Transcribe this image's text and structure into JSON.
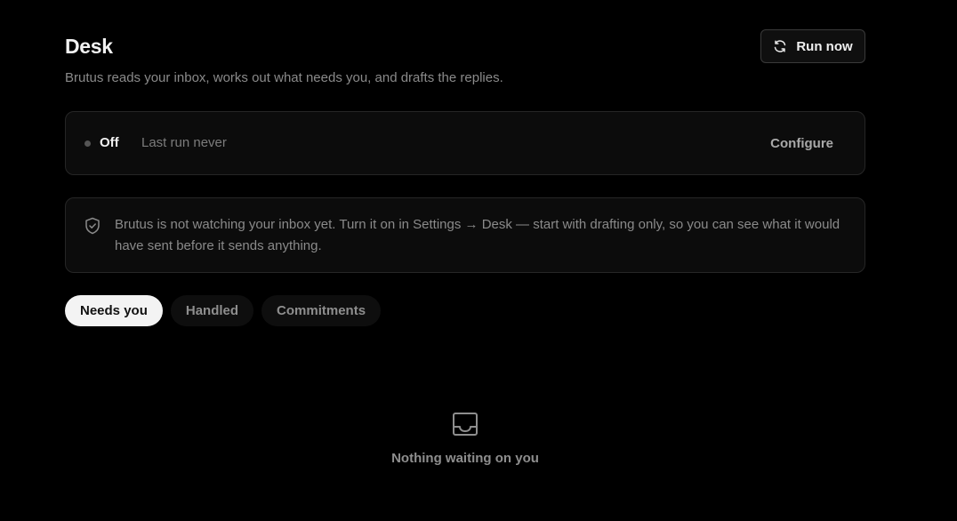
{
  "header": {
    "title": "Desk",
    "subtitle": "Brutus reads your inbox, works out what needs you, and drafts the replies.",
    "run_button_label": "Run now",
    "run_button_icon": "refresh-icon"
  },
  "status": {
    "state_label": "Off",
    "last_run": "Last run never",
    "configure_label": "Configure",
    "dot_color": "#555555"
  },
  "notice": {
    "icon": "shield-check-icon",
    "text": "Brutus is not watching your inbox yet. Turn it on in Settings → Desk — start with drafting only, so you can see what it would have sent before it sends anything."
  },
  "tabs": [
    {
      "label": "Needs you",
      "active": true
    },
    {
      "label": "Handled",
      "active": false
    },
    {
      "label": "Commitments",
      "active": false
    }
  ],
  "empty_state": {
    "icon": "inbox-icon",
    "text": "Nothing waiting on you"
  }
}
